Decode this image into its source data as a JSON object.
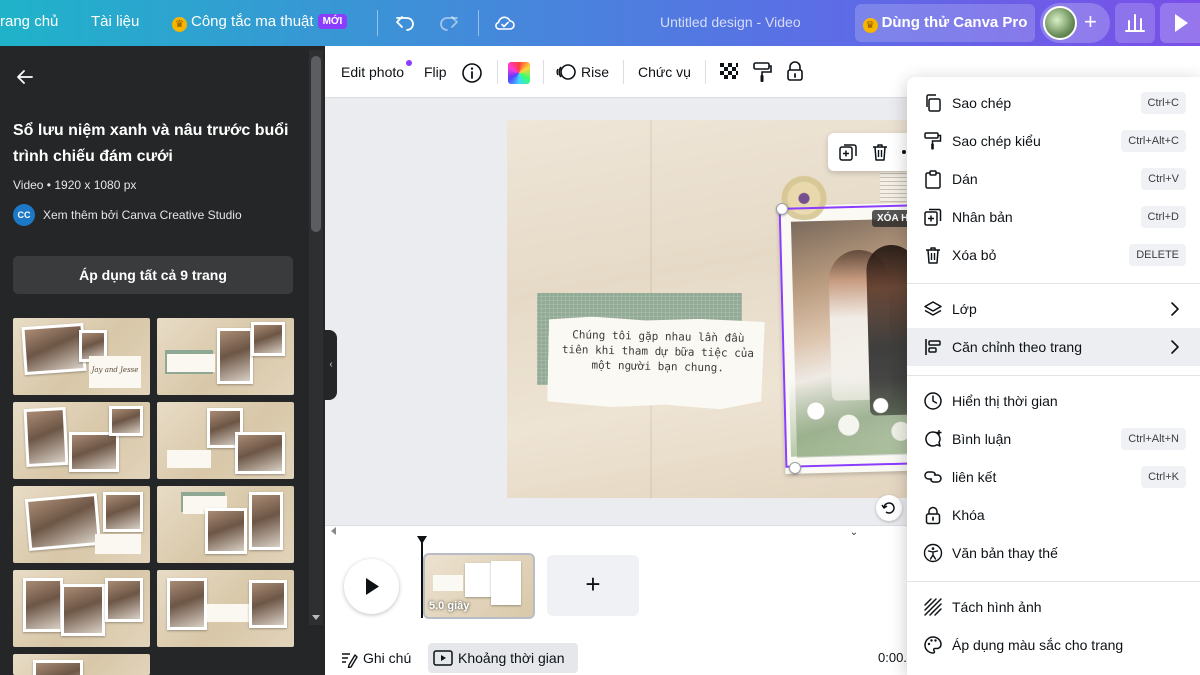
{
  "topbar": {
    "home": "rang chủ",
    "file": "Tài liệu",
    "magic": "Công tắc ma thuật",
    "new_badge": "MỚI",
    "doc_title": "Untitled design - Video",
    "try_pro": "Dùng thử Canva Pro",
    "plus": "+"
  },
  "left_panel": {
    "title": "Sổ lưu niệm xanh và nâu trước buổi trình chiếu đám cưới",
    "meta": "Video • 1920 x 1080 px",
    "creator_initials": "CC",
    "creator": "Xem thêm bởi Canva Creative Studio",
    "apply_button": "Áp dụng tất cả 9 trang",
    "collapse_glyph": "‹"
  },
  "context_toolbar": {
    "edit_photo": "Edit photo",
    "flip": "Flip",
    "animate": "Rise",
    "position": "Chức vụ"
  },
  "canvas": {
    "note_text": "Chúng tôi gặp nhau lần đầu tiên khi tham dự bữa tiệc của một người bạn chung.",
    "remove_bg_tag": "XÓA H",
    "thumb_note_text": "Jay and Jesse"
  },
  "timeline": {
    "scene_duration": "5.0 giây",
    "add_scene": "+",
    "collapse_glyph": "⌄",
    "notes_button": "Ghi chú",
    "timeline_button": "Khoảng thời gian",
    "time_readout": "0:00..."
  },
  "context_menu": {
    "items": [
      {
        "icon": "copy-icon",
        "label": "Sao chép",
        "shortcut": "Ctrl+C"
      },
      {
        "icon": "paint-roller-icon",
        "label": "Sao chép kiểu",
        "shortcut": "Ctrl+Alt+C"
      },
      {
        "icon": "clipboard-icon",
        "label": "Dán",
        "shortcut": "Ctrl+V"
      },
      {
        "icon": "duplicate-icon",
        "label": "Nhân bản",
        "shortcut": "Ctrl+D"
      },
      {
        "icon": "trash-icon",
        "label": "Xóa bỏ",
        "shortcut": "DELETE"
      },
      {
        "icon": "layers-icon",
        "label": "Lớp",
        "shortcut": ""
      },
      {
        "icon": "align-icon",
        "label": "Căn chỉnh theo trang",
        "shortcut": ""
      },
      {
        "icon": "clock-icon",
        "label": "Hiển thị thời gian",
        "shortcut": ""
      },
      {
        "icon": "comment-icon",
        "label": "Bình luận",
        "shortcut": "Ctrl+Alt+N"
      },
      {
        "icon": "link-icon",
        "label": "liên kết",
        "shortcut": "Ctrl+K"
      },
      {
        "icon": "lock-icon",
        "label": "Khóa",
        "shortcut": ""
      },
      {
        "icon": "accessibility-icon",
        "label": "Văn bản thay thế",
        "shortcut": ""
      },
      {
        "icon": "detach-image-icon",
        "label": "Tách hình ảnh",
        "shortcut": ""
      },
      {
        "icon": "palette-icon",
        "label": "Áp dụng màu sắc cho trang",
        "shortcut": ""
      }
    ]
  },
  "colors": {
    "accent": "#8b3dff",
    "panel_bg": "#252627",
    "menu_highlight": "#edeef1"
  }
}
